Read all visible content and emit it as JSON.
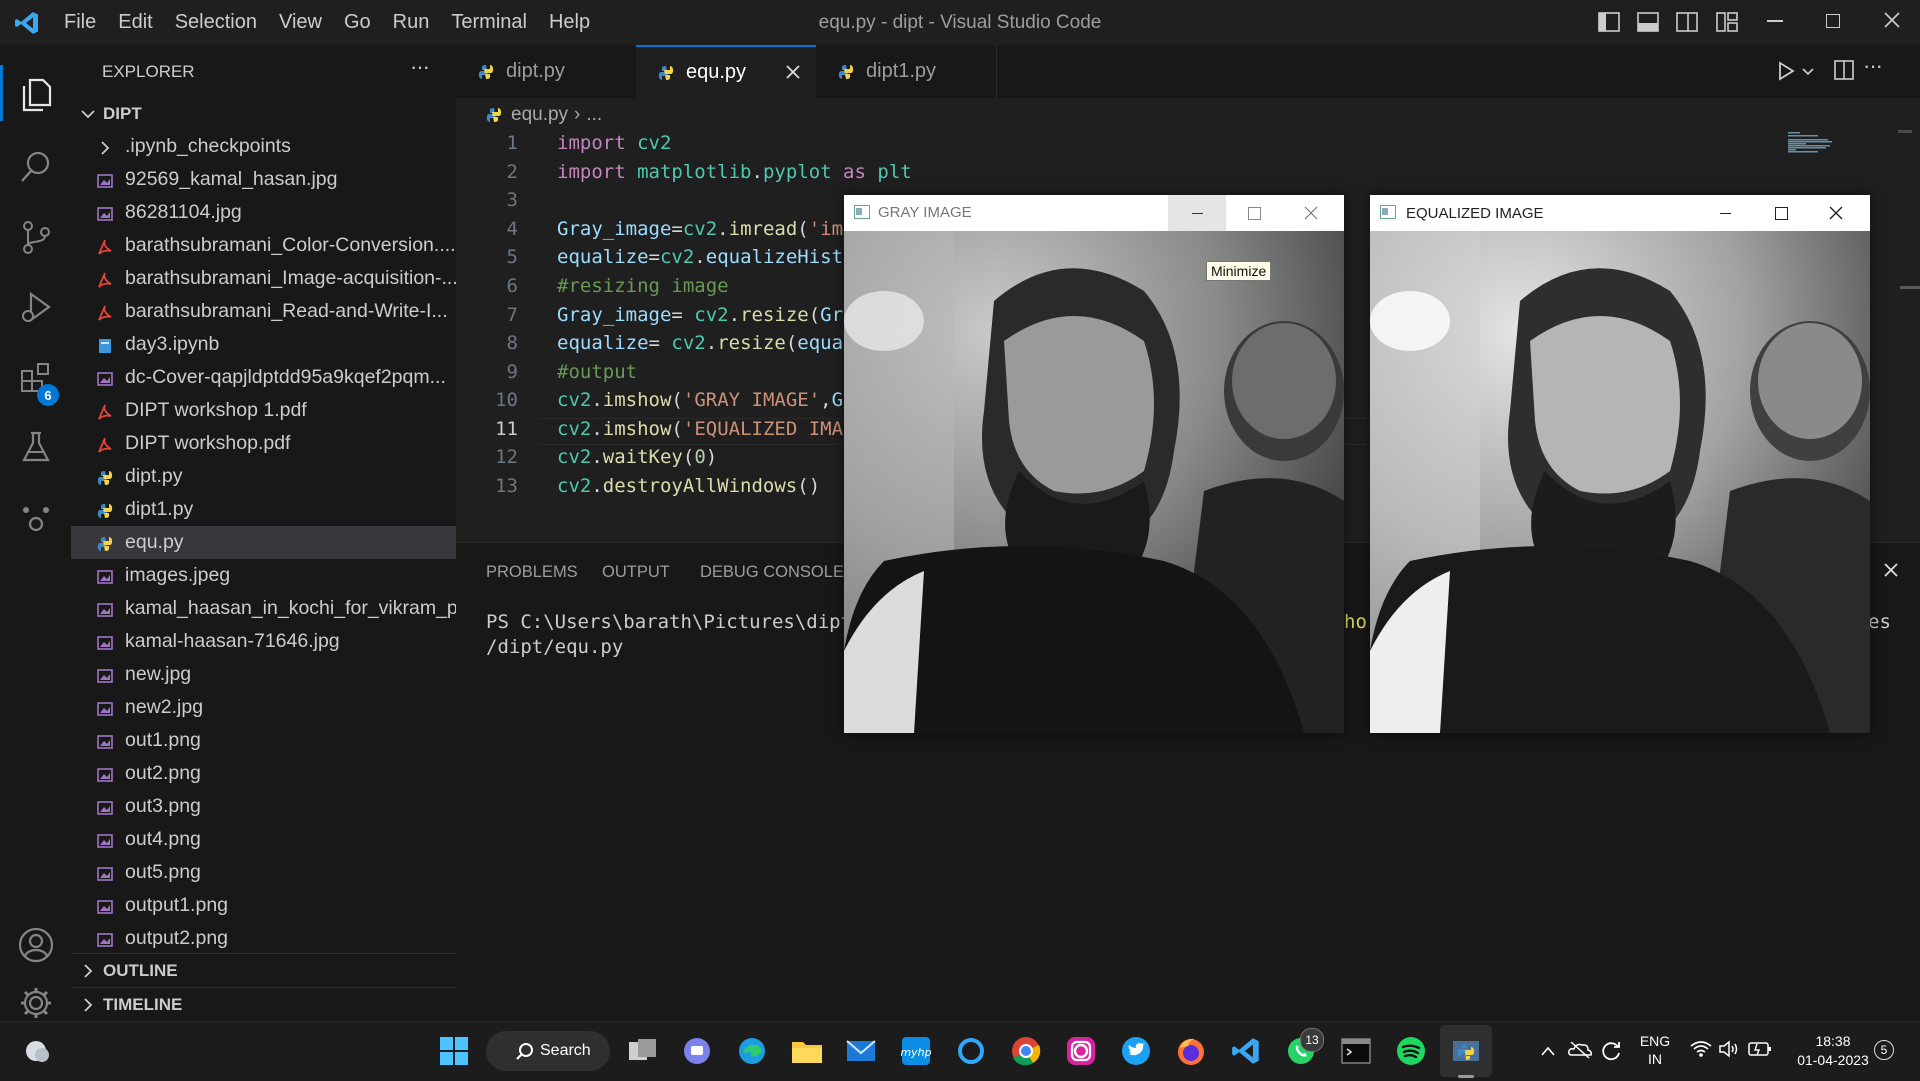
{
  "window": {
    "title": "equ.py - dipt - Visual Studio Code",
    "menu": [
      "File",
      "Edit",
      "Selection",
      "View",
      "Go",
      "Run",
      "Terminal",
      "Help"
    ]
  },
  "activity_bar": {
    "extensions_badge": "6"
  },
  "explorer": {
    "header": "EXPLORER",
    "more": "···",
    "root": "DIPT",
    "items": [
      {
        "label": ".ipynb_checkpoints",
        "icon": "chevron-right-icon"
      },
      {
        "label": "92569_kamal_hasan.jpg",
        "icon": "image-file-icon"
      },
      {
        "label": "86281104.jpg",
        "icon": "image-file-icon"
      },
      {
        "label": "barathsubramani_Color-Conversion....",
        "icon": "pdf-file-icon"
      },
      {
        "label": "barathsubramani_Image-acquisition-...",
        "icon": "pdf-file-icon"
      },
      {
        "label": "barathsubramani_Read-and-Write-I...",
        "icon": "pdf-file-icon"
      },
      {
        "label": "day3.ipynb",
        "icon": "notebook-file-icon"
      },
      {
        "label": "dc-Cover-qapjldptdd95a9kqef2pqm...",
        "icon": "image-file-icon"
      },
      {
        "label": "DIPT workshop 1.pdf",
        "icon": "pdf-file-icon"
      },
      {
        "label": "DIPT workshop.pdf",
        "icon": "pdf-file-icon"
      },
      {
        "label": "dipt.py",
        "icon": "python-file-icon"
      },
      {
        "label": "dipt1.py",
        "icon": "python-file-icon"
      },
      {
        "label": "equ.py",
        "icon": "python-file-icon"
      },
      {
        "label": "images.jpeg",
        "icon": "image-file-icon"
      },
      {
        "label": "kamal_haasan_in_kochi_for_vikram_p...",
        "icon": "image-file-icon"
      },
      {
        "label": "kamal-haasan-71646.jpg",
        "icon": "image-file-icon"
      },
      {
        "label": "new.jpg",
        "icon": "image-file-icon"
      },
      {
        "label": "new2.jpg",
        "icon": "image-file-icon"
      },
      {
        "label": "out1.png",
        "icon": "image-file-icon"
      },
      {
        "label": "out2.png",
        "icon": "image-file-icon"
      },
      {
        "label": "out3.png",
        "icon": "image-file-icon"
      },
      {
        "label": "out4.png",
        "icon": "image-file-icon"
      },
      {
        "label": "out5.png",
        "icon": "image-file-icon"
      },
      {
        "label": "output1.png",
        "icon": "image-file-icon"
      },
      {
        "label": "output2.png",
        "icon": "image-file-icon"
      }
    ],
    "selected": "equ.py",
    "outline": "OUTLINE",
    "timeline": "TIMELINE"
  },
  "tabs": [
    {
      "label": "dipt.py",
      "active": false
    },
    {
      "label": "equ.py",
      "active": true
    },
    {
      "label": "dipt1.py",
      "active": false
    }
  ],
  "breadcrumb": {
    "file": "equ.py",
    "sep": "›",
    "rest": "..."
  },
  "code": {
    "line_numbers": [
      "1",
      "2",
      "3",
      "4",
      "5",
      "6",
      "7",
      "8",
      "9",
      "10",
      "11",
      "12",
      "13"
    ],
    "active_line": "11",
    "lines": [
      "import cv2",
      "import matplotlib.pyplot as plt",
      "",
      "Gray_image=cv2.imread('im",
      "equalize=cv2.equalizeHist",
      "#resizing image",
      "Gray_image= cv2.resize(Gr",
      "equalize= cv2.resize(equa",
      "#output",
      "cv2.imshow('GRAY IMAGE',G",
      "cv2.imshow('EQUALIZED IMA",
      "cv2.waitKey(0)",
      "cv2.destroyAllWindows()"
    ]
  },
  "panel": {
    "tabs": [
      "PROBLEMS",
      "OUTPUT",
      "DEBUG CONSOLE"
    ],
    "terminal_line1": "PS C:\\Users\\barath\\Pictures\\dipt>",
    "terminal_line2": "/dipt/equ.py",
    "terminal_frag_a": "hor",
    "terminal_frag_b": "es"
  },
  "gray_window": {
    "title": "GRAY IMAGE",
    "tooltip": "Minimize"
  },
  "equalized_window": {
    "title": "EQUALIZED IMAGE"
  },
  "taskbar": {
    "search": "Search",
    "whatsapp_badge": "13",
    "lang_top": "ENG",
    "lang_bottom": "IN",
    "time": "18:38",
    "date": "01-04-2023",
    "notif": "5"
  },
  "colors": {
    "accent": "#0078d4",
    "keyword": "#c586c0",
    "function": "#dcdcaa",
    "string": "#ce9178",
    "comment": "#6a9955"
  }
}
